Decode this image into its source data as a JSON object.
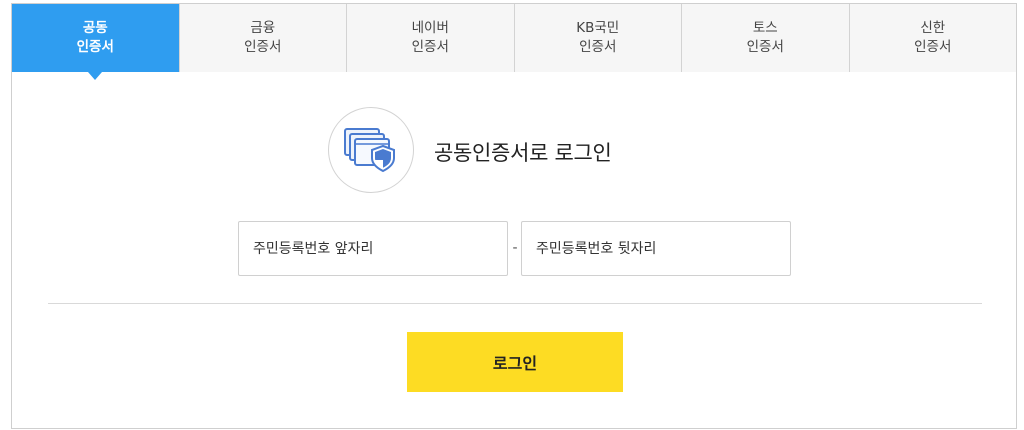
{
  "tabs": [
    {
      "line1": "공동",
      "line2": "인증서",
      "active": true
    },
    {
      "line1": "금융",
      "line2": "인증서",
      "active": false
    },
    {
      "line1": "네이버",
      "line2": "인증서",
      "active": false
    },
    {
      "line1": "KB국민",
      "line2": "인증서",
      "active": false
    },
    {
      "line1": "토스",
      "line2": "인증서",
      "active": false
    },
    {
      "line1": "신한",
      "line2": "인증서",
      "active": false
    }
  ],
  "login": {
    "icon": "certificate-shield-icon",
    "title": "공동인증서로 로그인",
    "rrn_front_placeholder": "주민등록번호 앞자리",
    "rrn_front_value": "",
    "separator": "-",
    "rrn_back_placeholder": "주민등록번호 뒷자리",
    "rrn_back_value": "",
    "button_label": "로그인"
  },
  "colors": {
    "active_tab": "#2f9df0",
    "login_button": "#fddc23",
    "icon_blue": "#4a7bd0"
  }
}
